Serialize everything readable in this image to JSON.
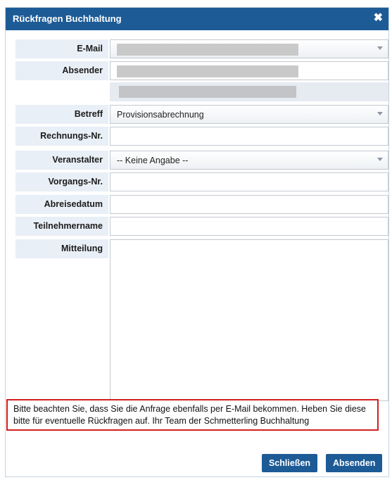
{
  "dialog": {
    "title": "Rückfragen Buchhaltung",
    "close_glyph": "✖"
  },
  "form": {
    "email": {
      "label": "E-Mail",
      "value": ""
    },
    "absender": {
      "label": "Absender",
      "value": ""
    },
    "betreff": {
      "label": "Betreff",
      "value": "Provisionsabrechnung"
    },
    "rechnungs_nr": {
      "label": "Rechnungs-Nr.",
      "value": ""
    },
    "veranstalter": {
      "label": "Veranstalter",
      "value": "-- Keine Angabe --"
    },
    "vorgangs_nr": {
      "label": "Vorgangs-Nr.",
      "value": ""
    },
    "abreisedatum": {
      "label": "Abreisedatum",
      "value": ""
    },
    "teilnehmername": {
      "label": "Teilnehmername",
      "value": ""
    },
    "mitteilung": {
      "label": "Mitteilung",
      "value": ""
    }
  },
  "notice": {
    "text": "Bitte beachten Sie, dass Sie die Anfrage ebenfalls per E-Mail bekommen. Heben Sie diese bitte für eventuelle Rückfragen auf. Ihr Team der Schmetterling Buchhaltung"
  },
  "buttons": {
    "close_label": "Schließen",
    "send_label": "Absenden"
  },
  "colors": {
    "titlebar": "#1d5b96",
    "label_bg": "#e9eff6",
    "notice_border": "#d21f1f"
  }
}
